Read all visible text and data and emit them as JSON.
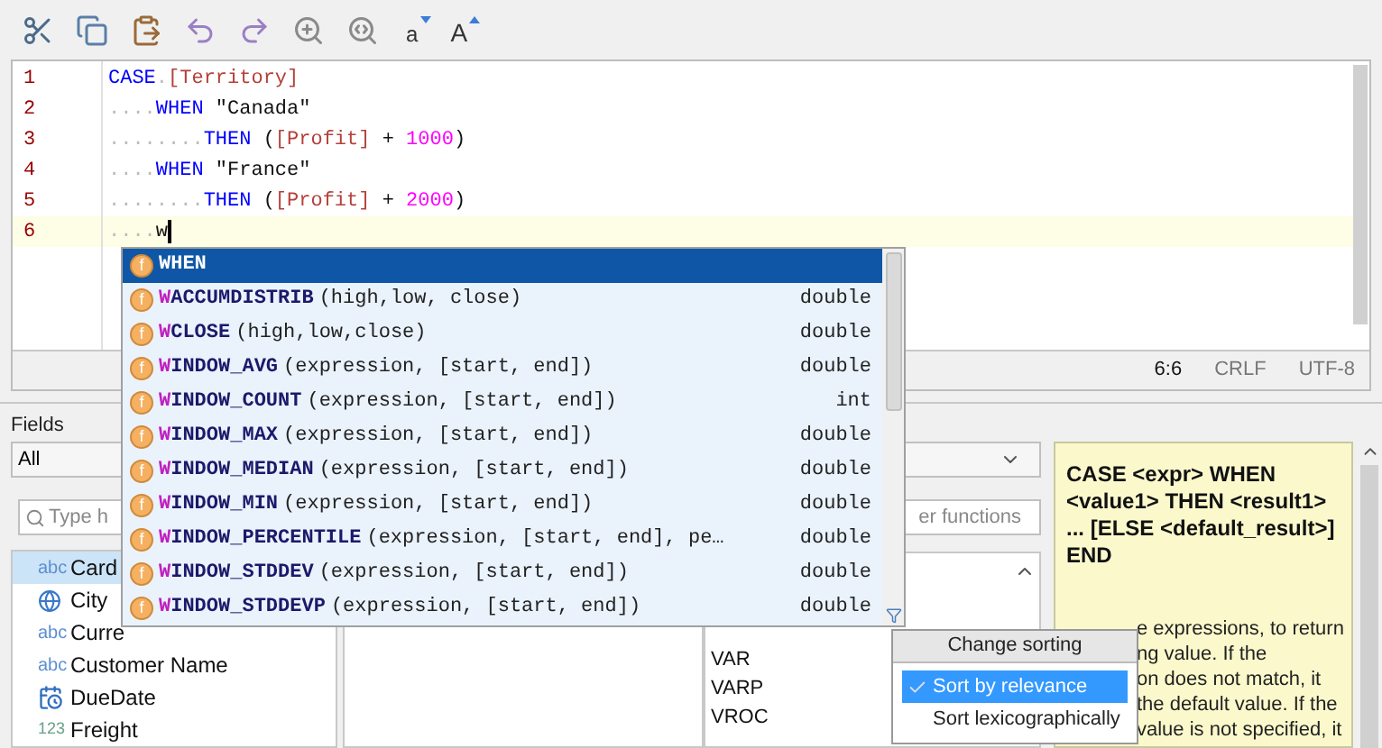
{
  "toolbar": [
    {
      "kind": "cut"
    },
    {
      "kind": "copy"
    },
    {
      "kind": "paste"
    },
    {
      "kind": "undo"
    },
    {
      "kind": "redo"
    },
    {
      "kind": "find"
    },
    {
      "kind": "replace"
    },
    {
      "kind": "lowercase",
      "glyph": "a"
    },
    {
      "kind": "uppercase",
      "glyph": "A"
    }
  ],
  "editor": {
    "lines": [
      {
        "number": "1",
        "current": false,
        "tokens": [
          {
            "kind": "keyword",
            "text": "CASE"
          },
          {
            "kind": "ws",
            "text": "."
          },
          {
            "kind": "field",
            "text": "[Territory]"
          }
        ]
      },
      {
        "number": "2",
        "current": false,
        "tokens": [
          {
            "kind": "ws",
            "text": "...."
          },
          {
            "kind": "keyword",
            "text": "WHEN"
          },
          {
            "kind": "plain",
            "text": " \"Canada\""
          }
        ]
      },
      {
        "number": "3",
        "current": false,
        "tokens": [
          {
            "kind": "ws",
            "text": "........"
          },
          {
            "kind": "keyword",
            "text": "THEN"
          },
          {
            "kind": "plain",
            "text": " ("
          },
          {
            "kind": "field",
            "text": "[Profit]"
          },
          {
            "kind": "plain",
            "text": " + "
          },
          {
            "kind": "number",
            "text": "1000"
          },
          {
            "kind": "plain",
            "text": ")"
          }
        ]
      },
      {
        "number": "4",
        "current": false,
        "tokens": [
          {
            "kind": "ws",
            "text": "...."
          },
          {
            "kind": "keyword",
            "text": "WHEN"
          },
          {
            "kind": "plain",
            "text": " \"France\""
          }
        ]
      },
      {
        "number": "5",
        "current": false,
        "tokens": [
          {
            "kind": "ws",
            "text": "........"
          },
          {
            "kind": "keyword",
            "text": "THEN"
          },
          {
            "kind": "plain",
            "text": " ("
          },
          {
            "kind": "field",
            "text": "[Profit]"
          },
          {
            "kind": "plain",
            "text": " + "
          },
          {
            "kind": "number",
            "text": "2000"
          },
          {
            "kind": "plain",
            "text": ")"
          }
        ]
      },
      {
        "number": "6",
        "current": true,
        "tokens": [
          {
            "kind": "ws",
            "text": "...."
          },
          {
            "kind": "plain",
            "text": "w"
          }
        ]
      }
    ],
    "status": {
      "position": "6:6",
      "line_ending": "CRLF",
      "encoding": "UTF-8"
    }
  },
  "fields": {
    "label": "Fields",
    "filter": "All",
    "search_placeholder": "Type h",
    "items": [
      {
        "kind": "text",
        "type_label": "abc",
        "name": "Card",
        "selected": true
      },
      {
        "kind": "geo",
        "name": "City",
        "selected": false
      },
      {
        "kind": "text",
        "type_label": "abc",
        "name": "Curre",
        "selected": false
      },
      {
        "kind": "text",
        "type_label": "abc",
        "name": "Customer Name",
        "selected": false
      },
      {
        "kind": "date",
        "name": "DueDate",
        "selected": false
      },
      {
        "kind": "number",
        "type_label": "123",
        "name": "Freight",
        "selected": false
      }
    ]
  },
  "functions": {
    "search_placeholder": "er functions",
    "items": [
      "VAR",
      "VARP",
      "VROC"
    ]
  },
  "help": {
    "title": "CASE <expr> WHEN <value1> THEN <result1> ... [ELSE <default_result>] END",
    "description_lines": [
      "e expressions, to return",
      "ng value. If the",
      "on does not match, it",
      "the default value. If the",
      "value is not specified, it"
    ]
  },
  "autocomplete": {
    "items": [
      {
        "badge": "f",
        "match": "W",
        "name": "HEN",
        "selected": true
      },
      {
        "badge": "f",
        "match": "W",
        "name": "ACCUMDISTRIB",
        "params": "(high,low, close)",
        "type": "double",
        "selected": false
      },
      {
        "badge": "f",
        "match": "W",
        "name": "CLOSE",
        "params": "(high,low,close)",
        "type": "double",
        "selected": false
      },
      {
        "badge": "f",
        "match": "W",
        "name": "INDOW_AVG",
        "params": "(expression, [start, end])",
        "type": "double",
        "selected": false
      },
      {
        "badge": "f",
        "match": "W",
        "name": "INDOW_COUNT",
        "params": "(expression, [start, end])",
        "type": "int",
        "selected": false
      },
      {
        "badge": "f",
        "match": "W",
        "name": "INDOW_MAX",
        "params": "(expression, [start, end])",
        "type": "double",
        "selected": false
      },
      {
        "badge": "f",
        "match": "W",
        "name": "INDOW_MEDIAN",
        "params": "(expression, [start, end])",
        "type": "double",
        "selected": false
      },
      {
        "badge": "f",
        "match": "W",
        "name": "INDOW_MIN",
        "params": "(expression, [start, end])",
        "type": "double",
        "selected": false
      },
      {
        "badge": "f",
        "match": "W",
        "name": "INDOW_PERCENTILE",
        "params": "(expression, [start, end], pe…",
        "type": "double",
        "selected": false
      },
      {
        "badge": "f",
        "match": "W",
        "name": "INDOW_STDDEV",
        "params": "(expression, [start, end])",
        "type": "double",
        "selected": false
      },
      {
        "badge": "f",
        "match": "W",
        "name": "INDOW_STDDEVP",
        "params": "(expression, [start, end])",
        "type": "double",
        "selected": false
      }
    ]
  },
  "sorting_menu": {
    "title": "Change sorting",
    "options": [
      {
        "label": "Sort by relevance",
        "selected": true
      },
      {
        "label": "Sort lexicographically",
        "selected": false
      }
    ]
  }
}
